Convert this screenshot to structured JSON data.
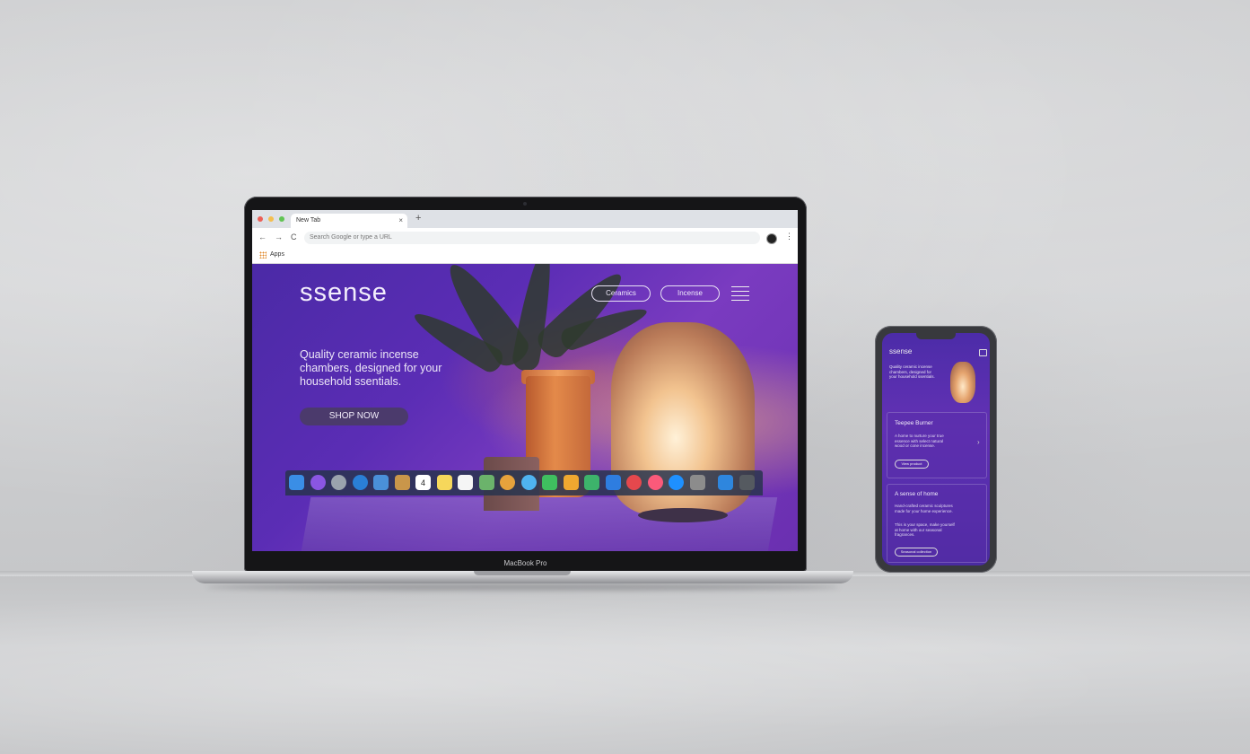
{
  "laptop": {
    "model_label": "MacBook Pro"
  },
  "browser": {
    "tab_title": "New Tab",
    "tab_close": "×",
    "new_tab": "+",
    "back": "←",
    "forward": "→",
    "reload": "C",
    "omnibox_placeholder": "Search Google or type a URL",
    "menu": "⋮",
    "bookmarks": {
      "apps_label": "Apps"
    },
    "window_colors": [
      "#ec5f57",
      "#f4bf4f",
      "#61c454"
    ]
  },
  "site": {
    "brand": "ssense",
    "nav": [
      {
        "label": "Ceramics"
      },
      {
        "label": "Incense"
      }
    ],
    "headline": "Quality ceramic incense chambers, designed for your household ssentials.",
    "cta": "SHOP NOW"
  },
  "dock": {
    "apps": [
      "finder-icon",
      "siri-icon",
      "launchpad-icon",
      "safari-icon",
      "mail-icon",
      "contacts-icon",
      "calendar-icon",
      "notes-icon",
      "reminders-icon",
      "maps-icon",
      "photos-icon",
      "messages-icon",
      "facetime-icon",
      "pages-icon",
      "numbers-icon",
      "keynote-icon",
      "news-icon",
      "music-icon",
      "appstore-icon",
      "settings-icon",
      "downloads-icon",
      "trash-icon"
    ],
    "calendar_day": "4"
  },
  "phone": {
    "brand": "ssense",
    "hero_text": "Quality ceramic incense chambers, designed for your household ssentials.",
    "card1": {
      "title": "Teepee Burner",
      "body": "A home to nurture your true essence with select natural wood or cone incense.",
      "button": "View product"
    },
    "card2": {
      "title": "A sense of home",
      "body1": "Hand-crafted ceramic sculptures made for your home experience.",
      "body2": "This is your space, make yourself at home with our seasonal fragrances.",
      "button": "Seasonal collection"
    }
  },
  "colors": {
    "accent": "#5b2db5",
    "cta_bg": "#4b3a6c"
  }
}
